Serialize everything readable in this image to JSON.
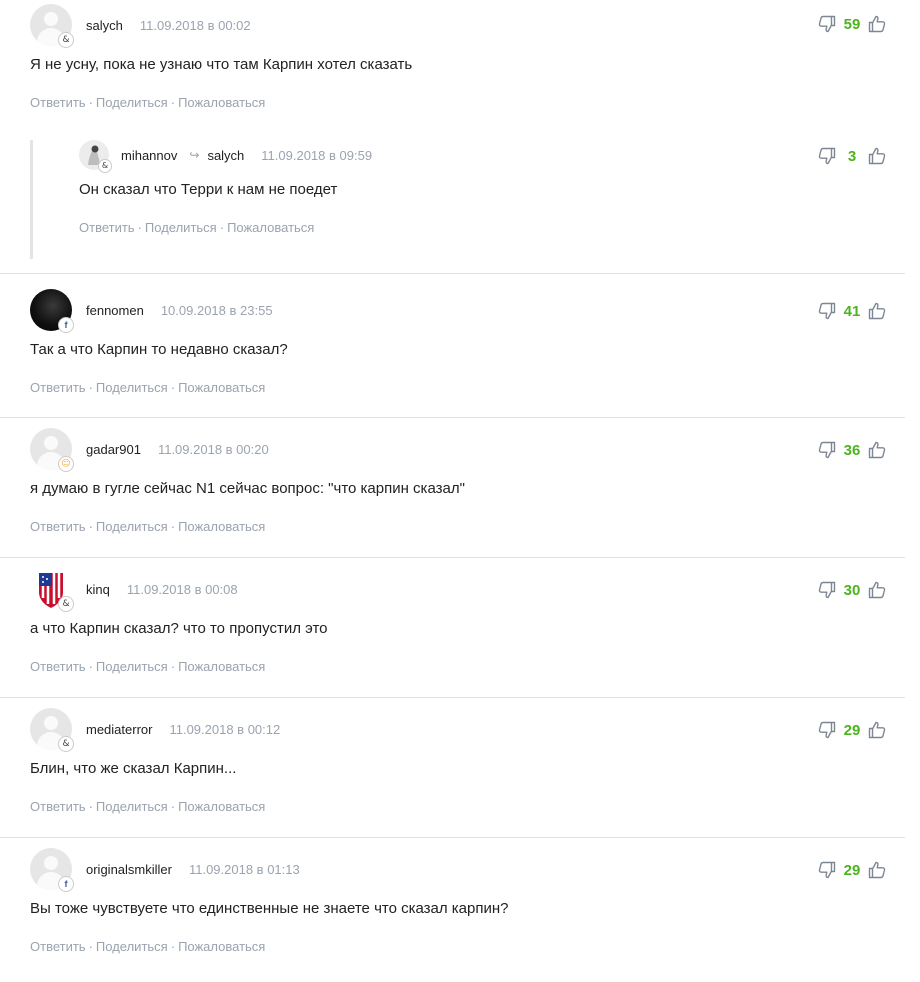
{
  "actions": {
    "reply": "Ответить",
    "share": "Поделиться",
    "report": "Пожаловаться",
    "separator": "·"
  },
  "colors": {
    "vote_positive": "#4db31f",
    "muted": "#9aa3af",
    "text": "#222222"
  },
  "comments": [
    {
      "username": "salych",
      "date": "11.09.2018 в 00:02",
      "text": "Я не усну, пока не узнаю что там Карпин хотел сказать",
      "votes": "59",
      "badge": "&",
      "reply": {
        "username": "mihannov",
        "reply_to": "salych",
        "date": "11.09.2018 в 09:59",
        "text": "Он сказал что Терри к нам не поедет",
        "votes": "3",
        "badge": "&"
      }
    },
    {
      "username": "fennomen",
      "date": "10.09.2018 в 23:55",
      "text": "Так а что Карпин то недавно сказал?",
      "votes": "41",
      "badge": "f"
    },
    {
      "username": "gadar901",
      "date": "11.09.2018 в 00:20",
      "text": "я думаю в гугле сейчас N1 сейчас вопрос: \"что карпин сказал\"",
      "votes": "36",
      "badge": "☺"
    },
    {
      "username": "kinq",
      "date": "11.09.2018 в 00:08",
      "text": "а что Карпин сказал? что то пропустил это",
      "votes": "30",
      "badge": "&"
    },
    {
      "username": "mediaterror",
      "date": "11.09.2018 в 00:12",
      "text": "Блин, что же сказал Карпин...",
      "votes": "29",
      "badge": "&"
    },
    {
      "username": "originalsmkiller",
      "date": "11.09.2018 в 01:13",
      "text": "Вы тоже чувствуете что единственные не знаете что сказал карпин?",
      "votes": "29",
      "badge": "f"
    }
  ]
}
